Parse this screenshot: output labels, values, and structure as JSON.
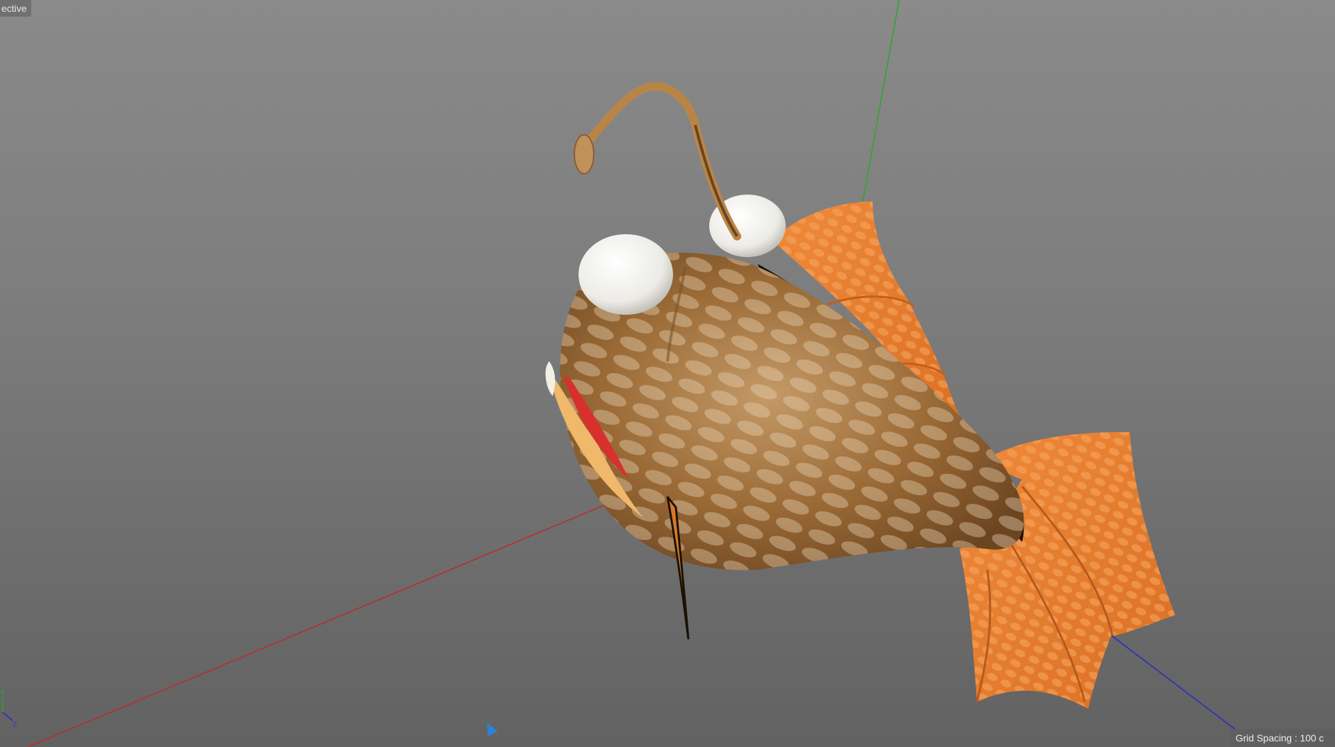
{
  "viewport": {
    "view_label": "ective",
    "grid_spacing": "Grid Spacing : 100 c",
    "gizmo": {
      "y_label": "Y",
      "z_label": "Z"
    }
  },
  "colors": {
    "x_axis": "#c0282a",
    "y_axis": "#2aa82a",
    "z_axis": "#2a2ac0",
    "fin": "#e37f33",
    "body": "#9a6a36"
  },
  "icons": [
    "axis-gizmo-icon",
    "navigation-arrow-icon"
  ]
}
